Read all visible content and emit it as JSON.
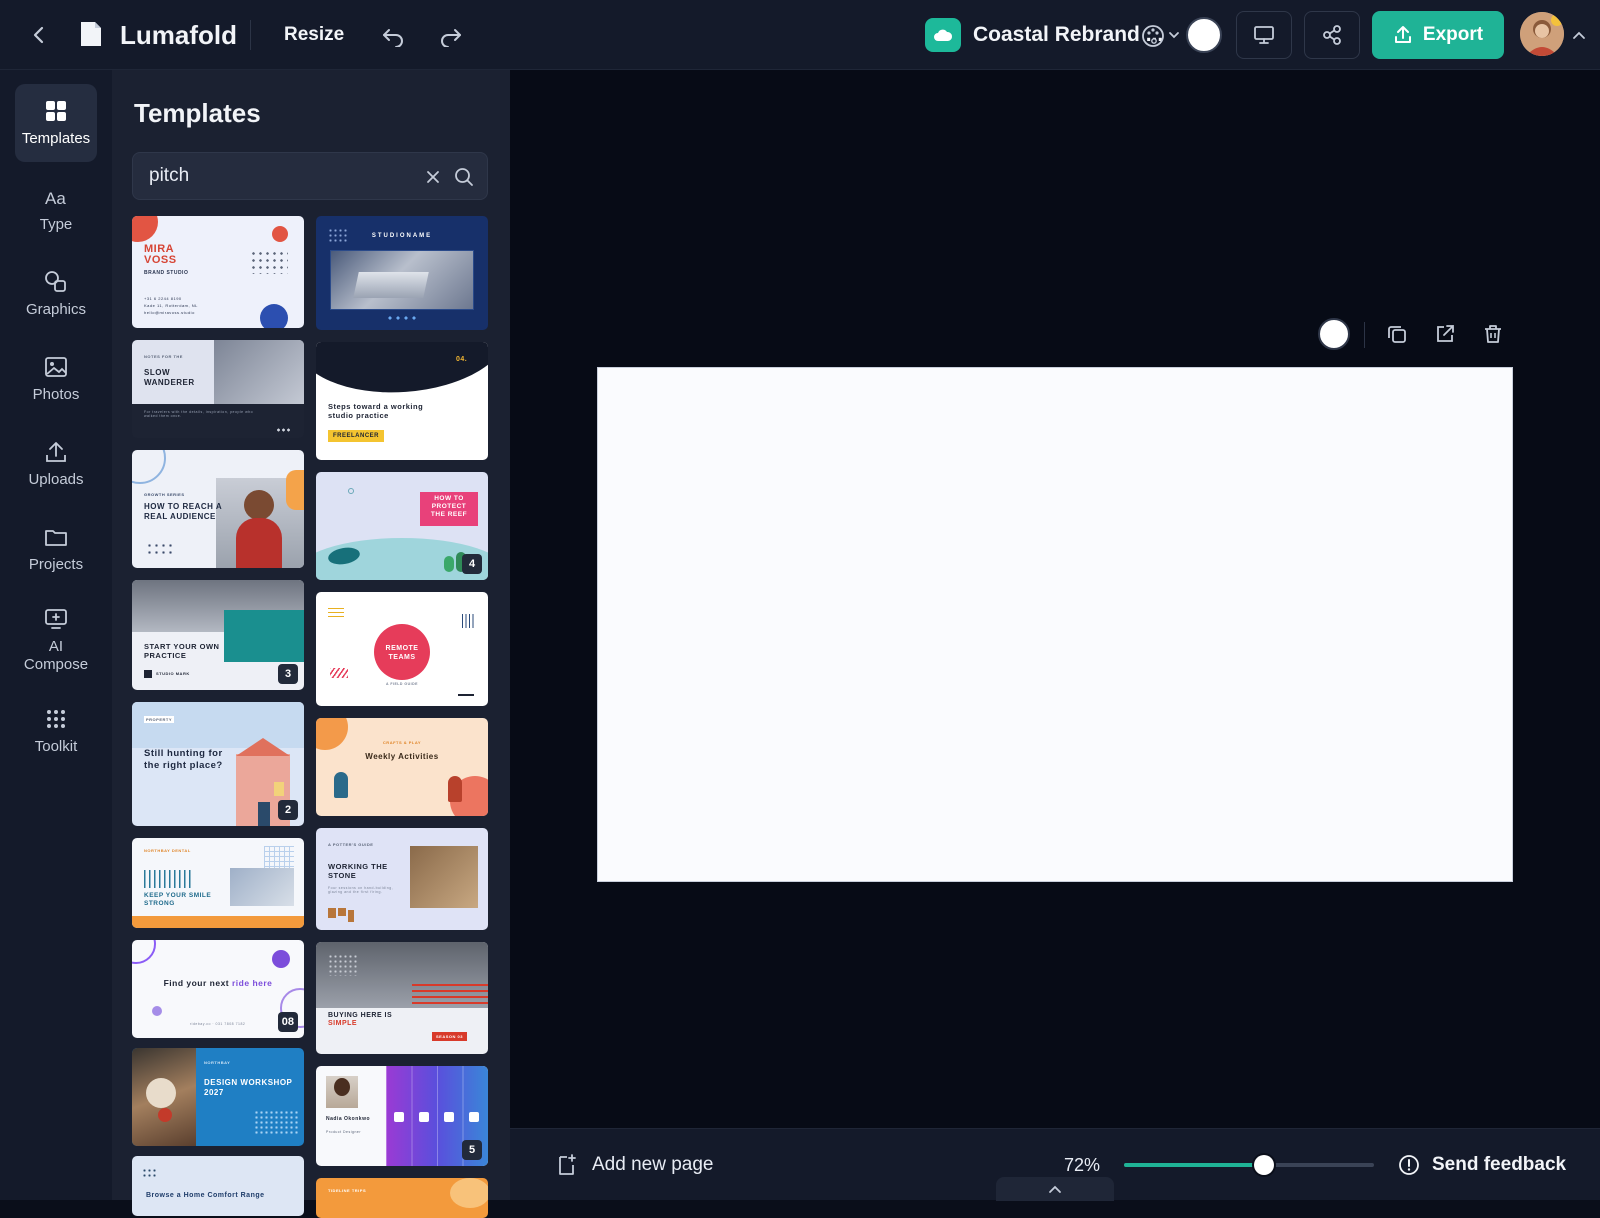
{
  "topbar": {
    "app_name": "Lumafold",
    "resize_label": "Resize",
    "project_title": "Coastal Rebrand ...",
    "export_label": "Export",
    "icons": [
      "back-icon",
      "document-icon",
      "undo-icon",
      "redo-icon",
      "cloud-icon",
      "palette-icon",
      "present-icon",
      "share-icon",
      "upload-icon",
      "chevron-up-icon"
    ]
  },
  "rail": {
    "items": [
      {
        "label": "Templates",
        "icon": "grid-icon",
        "active": true
      },
      {
        "label": "Type",
        "icon": "type-icon"
      },
      {
        "label": "Graphics",
        "icon": "shapes-icon"
      },
      {
        "label": "Photos",
        "icon": "image-icon"
      },
      {
        "label": "Uploads",
        "icon": "upload-icon"
      },
      {
        "label": "Projects",
        "icon": "folder-icon"
      },
      {
        "label": "AI Compose",
        "icon": "ai-compose-icon"
      },
      {
        "label": "Toolkit",
        "icon": "dots-grid-icon"
      }
    ]
  },
  "panel": {
    "title": "Templates",
    "search_value": "pitch"
  },
  "templates": {
    "t1": {
      "title": "MIRA VOSS",
      "sub": "BRAND STUDIO",
      "contact": "+31 6 2244 8190",
      "contact2": "Kade 11, Rotterdam, NL",
      "contact3": "hello@miravoss.studio"
    },
    "t2": {
      "title": "STUDIONAME"
    },
    "t3": {
      "kicker": "NOTES FOR THE",
      "title": "SLOW WANDERER",
      "body": "For travelers with the details, inspiration, people who walked them once."
    },
    "t4": {
      "num": "04.",
      "title": "Steps toward a working studio practice",
      "tag": "FREELANCER"
    },
    "t5": {
      "kicker": "GROWTH SERIES",
      "title": "HOW TO REACH A REAL AUDIENCE"
    },
    "t6": {
      "title": "HOW TO PROTECT THE REEF",
      "badge": "4"
    },
    "t7": {
      "title": "START YOUR OWN PRACTICE",
      "mark": "STUDIO MARK",
      "badge": "3"
    },
    "t8": {
      "title": "REMOTE TEAMS",
      "sub": "A FIELD GUIDE"
    },
    "t9": {
      "kicker": "PROPERTY",
      "title": "Still hunting for the right place?",
      "badge": "2"
    },
    "t10": {
      "kicker": "CRAFTS & PLAY",
      "title": "Weekly Activities"
    },
    "t11": {
      "kicker": "NORTHBAY DENTAL",
      "title": "KEEP YOUR SMILE STRONG"
    },
    "t12": {
      "kicker": "A POTTER'S GUIDE",
      "title": "WORKING THE STONE",
      "body": "Four sessions on hand-building, glazing and the first firing."
    },
    "t13": {
      "title_a": "Find your next ",
      "title_b": "ride here",
      "contact": "ridebay.co · 031 7808 7182",
      "badge": "08"
    },
    "t14": {
      "title_a": "BUYING HERE IS",
      "title_b": "SIMPLE",
      "tag": "SEASON 03"
    },
    "t15": {
      "kicker": "NORTHBAY",
      "title": "DESIGN WORKSHOP 2027"
    },
    "t16": {
      "name": "Nadia Okonkwo",
      "role": "Product Designer",
      "badge": "5"
    },
    "t17": {
      "title": "Browse a Home Comfort Range"
    },
    "t18": {
      "title": "TIDELINE TRIPS"
    }
  },
  "canvas": {
    "tools": [
      "color-swatch",
      "duplicate-icon",
      "open-new-icon",
      "trash-icon"
    ]
  },
  "bottombar": {
    "add_page_label": "Add new page",
    "zoom_value": "72%",
    "zoom_level": 0.56,
    "feedback_label": "Send feedback"
  }
}
